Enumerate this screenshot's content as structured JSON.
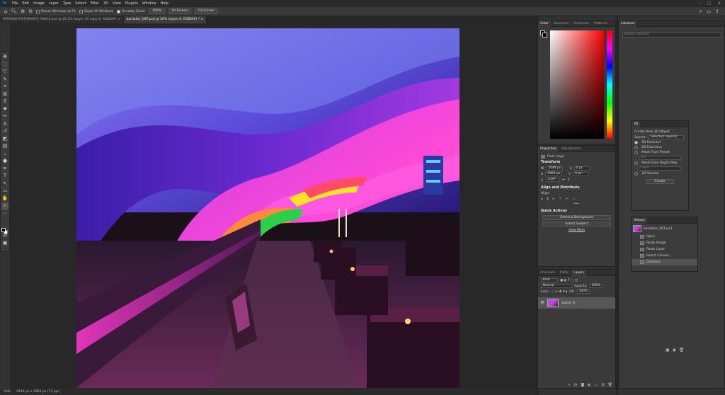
{
  "menubar": {
    "items": [
      "File",
      "Edit",
      "Image",
      "Layer",
      "Type",
      "Select",
      "Filter",
      "3D",
      "View",
      "Plugins",
      "Window",
      "Help"
    ],
    "logo": "Ps",
    "window_controls": [
      "–",
      "□",
      "✕"
    ]
  },
  "options": {
    "resize_windows": "Resize Windows to Fit",
    "zoom_all": "Zoom All Windows",
    "scrubby_zoom": "Scrubby Zoom",
    "zoom_value": "100%",
    "fit_screen": "Fit Screen",
    "fill_screen": "Fill Screen"
  },
  "tabs": [
    {
      "label": "INTERNO RISTORANTE FINALE.psd @ 22,5% (Layer 55 copy 8, RGB/8#) ×"
    },
    {
      "label": "bardallar_DEF.psd @ 50% (Layer 0, RGB/8#) * ×"
    }
  ],
  "status": {
    "zoom": "50%",
    "dimensions": "2649 px x 2960 px (72 ppi)"
  },
  "color_panel": {
    "tabs": [
      "Color",
      "Swatches",
      "Gradients",
      "Patterns"
    ],
    "hue_colors": [
      "#ff0000",
      "#ff00ff",
      "#0000ff",
      "#00ffff",
      "#00ff00",
      "#ffff00",
      "#ff0000"
    ],
    "picked_color": "#ff0000"
  },
  "properties": {
    "tabs": [
      "Properties",
      "Adjustments"
    ],
    "layer_kind": "Pixel Layer",
    "transform_title": "Transform",
    "w_label": "W",
    "w_value": "2649 px",
    "h_label": "H",
    "h_value": "2960 px",
    "x_label": "X",
    "x_value": "0 px",
    "y_label": "Y",
    "y_value": "0 px",
    "angle_value": "0,00°",
    "align_title": "Align and Distribute",
    "align_label": "Align:",
    "more": "•••",
    "quick_title": "Quick Actions",
    "remove_bg": "Remove Background",
    "select_subject": "Select Subject",
    "view_more": "View More"
  },
  "layers": {
    "tabs": [
      "Channels",
      "Paths",
      "Layers"
    ],
    "kind": "Kind",
    "blend_mode": "Normal",
    "opacity_label": "Opacity:",
    "opacity_value": "100%",
    "lock_label": "Lock:",
    "fill_label": "Fill:",
    "fill_value": "100%",
    "layer_name": "Layer 0"
  },
  "libraries": {
    "title": "Libraries",
    "search_placeholder": "Search Libraries"
  },
  "panel3d": {
    "title": "3D",
    "create_new": "Create New 3D Object",
    "source_label": "Source:",
    "source_value": "Selected Layer(s)",
    "options": [
      "3D Postcard",
      "3D Extrusion",
      "Mesh From Preset",
      "Mesh From Depth Map",
      "3D Volume"
    ],
    "preset_value": "Hat",
    "depth_value": "Plane",
    "create_btn": "Create"
  },
  "history": {
    "title": "History",
    "snapshot": "bardallar_DEF.psd",
    "steps": [
      "Open",
      "Paste Image",
      "Paste Layer",
      "Select Canvas",
      "Deselect"
    ]
  }
}
